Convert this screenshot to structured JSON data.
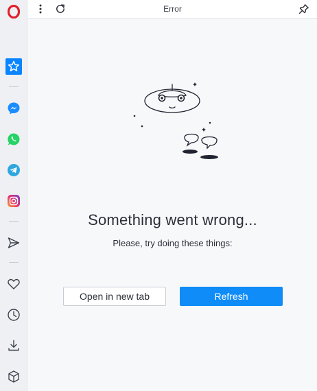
{
  "topbar": {
    "title": "Error",
    "menu_icon": "kebab-menu-icon",
    "reload_icon": "reload-icon",
    "pin_icon": "pin-icon"
  },
  "sidebar": {
    "items": [
      {
        "name": "opera-logo",
        "icon": "opera-logo-icon",
        "color": "#e0212b"
      },
      {
        "name": "speed-dial",
        "icon": "star-icon",
        "color": "#0a85ff",
        "active": true
      },
      {
        "name": "messenger",
        "icon": "messenger-icon",
        "color": "#1a8cff"
      },
      {
        "name": "whatsapp",
        "icon": "whatsapp-icon",
        "color": "#25d366"
      },
      {
        "name": "telegram",
        "icon": "telegram-icon",
        "color": "#2ea6e0"
      },
      {
        "name": "instagram",
        "icon": "instagram-icon",
        "color": "#e1306c"
      },
      {
        "name": "send",
        "icon": "send-icon"
      },
      {
        "name": "favorites",
        "icon": "heart-icon"
      },
      {
        "name": "history",
        "icon": "clock-icon"
      },
      {
        "name": "downloads",
        "icon": "download-icon"
      },
      {
        "name": "extensions",
        "icon": "cube-icon"
      }
    ]
  },
  "error": {
    "heading": "Something went wrong...",
    "subtext": "Please, try doing these things:",
    "illustration": "ufo-illustration"
  },
  "actions": {
    "open_new_tab_label": "Open in new tab",
    "refresh_label": "Refresh"
  },
  "colors": {
    "accent": "#0f8cf8",
    "sidebar_bg": "#eef0f4",
    "page_bg": "#f7f8fa"
  }
}
